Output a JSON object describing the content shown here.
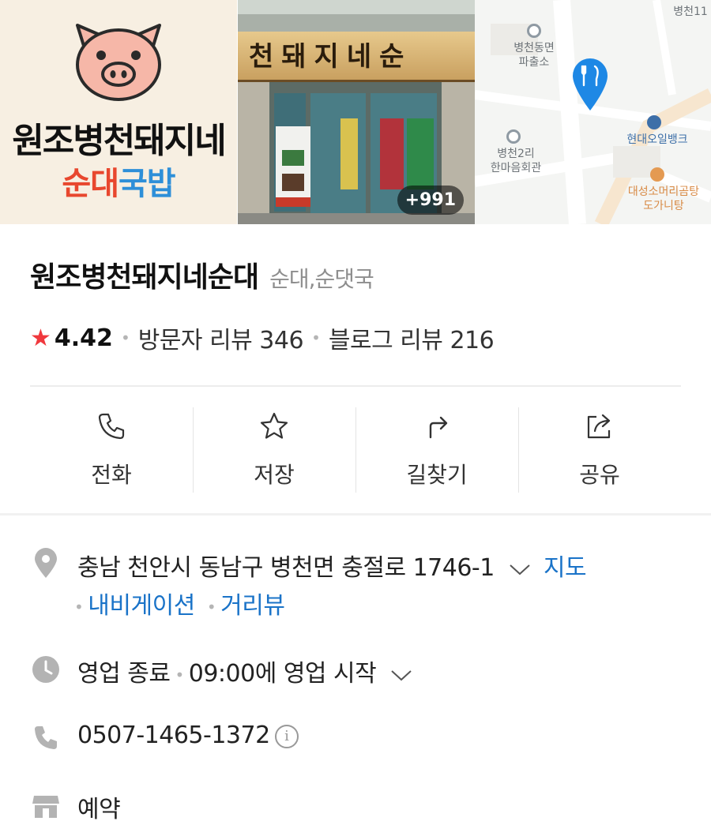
{
  "photos": {
    "logo": {
      "line1": "원조병천돼지네",
      "line2_part1": "순대",
      "line2_part2": "국밥"
    },
    "store": {
      "sign_text": "천돼지네순",
      "photo_count": "+991"
    },
    "map": {
      "labels": [
        "병천동면\n파출소",
        "현대오일뱅크",
        "병천2리\n한마음회관",
        "대성소머리곰탕\n도가니탕",
        "병천11"
      ]
    }
  },
  "place": {
    "name": "원조병천돼지네순대",
    "category": "순대,순댓국",
    "rating": "4.42",
    "visitor_reviews": "방문자 리뷰 346",
    "blog_reviews": "블로그 리뷰 216"
  },
  "actions": [
    {
      "label": "전화",
      "icon": "phone-icon"
    },
    {
      "label": "저장",
      "icon": "star-outline-icon"
    },
    {
      "label": "길찾기",
      "icon": "directions-icon"
    },
    {
      "label": "공유",
      "icon": "share-icon"
    }
  ],
  "info": {
    "address": "충남 천안시 동남구 병천면 충절로 1746-1",
    "map_link": "지도",
    "navigation_link": "내비게이션",
    "streetview_link": "거리뷰",
    "status": "영업 종료",
    "hours": "09:00에 영업 시작",
    "phone": "0507-1465-1372",
    "reservation": "예약"
  },
  "colors": {
    "accent_star": "#f0383d",
    "link": "#1a73c8",
    "map_pin": "#1e88e5"
  }
}
